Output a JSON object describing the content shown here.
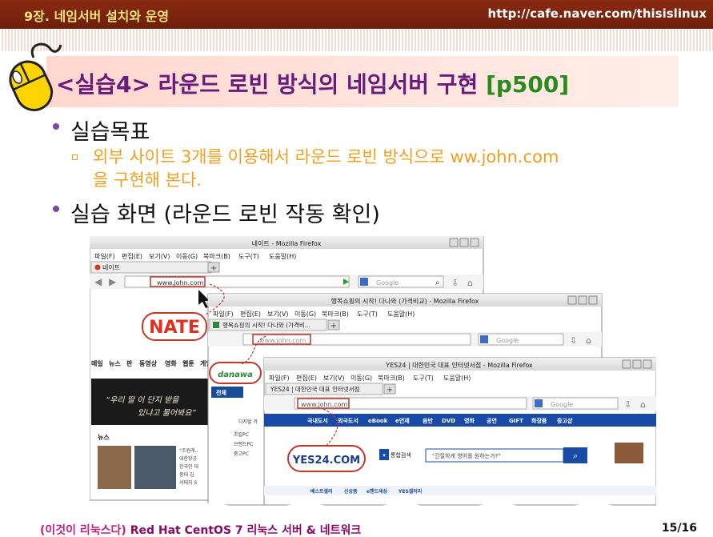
{
  "header": {
    "chapter": "9장. 네임서버 설치와 운영",
    "url": "http://cafe.naver.com/thisislinux"
  },
  "title": {
    "main": "<실습4> 라운드 로빈 방식의 네임서버 구현 ",
    "page": "[p500]"
  },
  "bullets": {
    "goal": "실습목표",
    "goal_detail_1": "외부 사이트 3개를 이용해서 라운드 로빈 방식으로 ww.john.com",
    "goal_detail_2": "을 구현해 본다.",
    "screen": "실습 화면 (라운드 로빈 작동 확인)"
  },
  "windows": {
    "nate": {
      "title": "네이트 - Mozilla Firefox",
      "tab": "네이트",
      "address": "www.john.com",
      "search": "Google",
      "logo": "NATE",
      "nav": [
        "메일",
        "뉴스",
        "판",
        "동영상",
        "영화",
        "웹툰",
        "게임"
      ],
      "side": "뉴스"
    },
    "danawa": {
      "title": "행복쇼핑의 시작! 다나와 (가격비교) - Mozilla Firefox",
      "tab": "행복쇼핑의 시작! 다나와 (가격비...",
      "address": "www.john.com",
      "search": "Google",
      "logo": "danawa",
      "cat": "전체",
      "side": [
        "디지털 카",
        "조립PC",
        "브랜드PC",
        "중고PC"
      ]
    },
    "yes24": {
      "title": "YES24 | 대한민국 대표 인터넷서점 - Mozilla Firefox",
      "tab": "YES24 | 대한민국 대표 인터넷서점",
      "address": "www.john.com",
      "search": "Google",
      "logo": "YES24.COM",
      "nav": [
        "국내도서",
        "외국도서",
        "eBook",
        "e연재",
        "음반",
        "DVD",
        "영화",
        "공연",
        "GIFT",
        "화장품",
        "중고샵"
      ],
      "search_placeholder": "\"간절하게 영어를 원하는가?\"",
      "search_label": "통합검색",
      "bottom_nav": [
        "베스트셀러",
        "신상품",
        "e핸드세상",
        "YES갤러리"
      ]
    },
    "menu": [
      "파일(F)",
      "편집(E)",
      "보기(V)",
      "이동(G)",
      "북마크(B)",
      "도구(T)",
      "도움말(H)"
    ]
  },
  "footer": {
    "book_tag": "(이것이 리눅스다)",
    "book": " Red Hat CentOS 7 리눅스 서버 & 네트워크",
    "page": "15/16"
  }
}
